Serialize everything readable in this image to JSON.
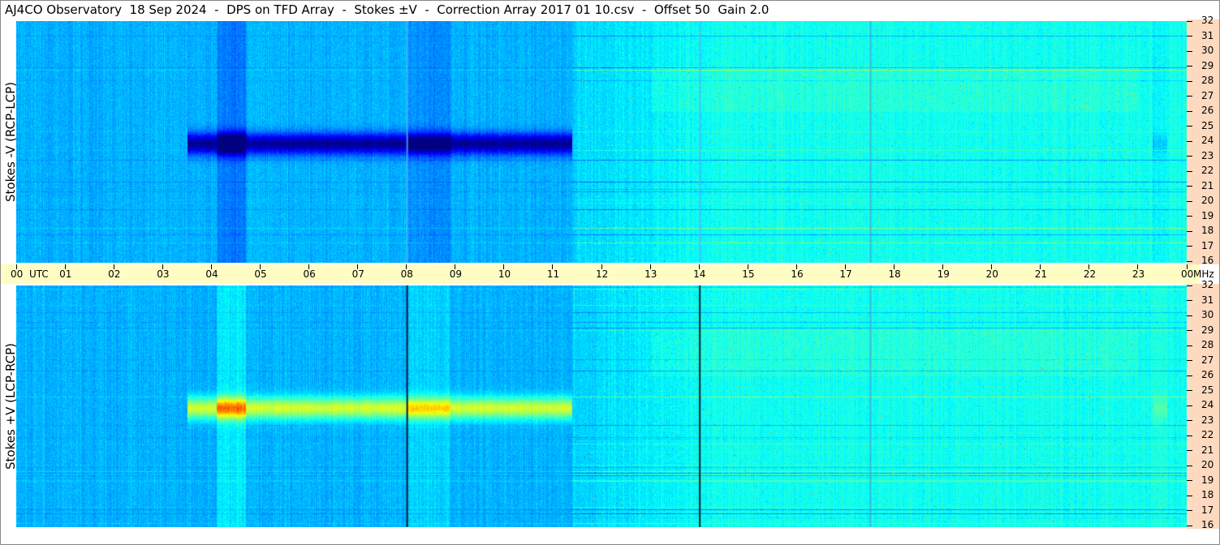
{
  "title": "AJ4CO Observatory  18 Sep 2024  -  DPS on TFD Array  -  Stokes ±V  -  Correction Array 2017 01 10.csv  -  Offset 50  Gain 2.0",
  "chart_data": [
    {
      "type": "heatmap",
      "ylabel": "Stokes -V (RCP-LCP)",
      "y_unit": "MHz",
      "x_ticks": [
        "00",
        "01",
        "02",
        "03",
        "04",
        "05",
        "06",
        "07",
        "08",
        "09",
        "10",
        "11",
        "12",
        "13",
        "14",
        "15",
        "16",
        "17",
        "18",
        "19",
        "20",
        "21",
        "22",
        "23",
        "00"
      ],
      "x_range": [
        0,
        24
      ],
      "y_ticks": [
        "32",
        "31",
        "30",
        "29",
        "28",
        "27",
        "26",
        "25",
        "24",
        "23",
        "22",
        "21",
        "20",
        "19",
        "18",
        "17",
        "16"
      ],
      "y_range": [
        16,
        32
      ]
    },
    {
      "type": "heatmap",
      "ylabel": "Stokes +V (LCP-RCP)",
      "y_unit": "MHz",
      "x_ticks": [
        "00",
        "01",
        "02",
        "03",
        "04",
        "05",
        "06",
        "07",
        "08",
        "09",
        "10",
        "11",
        "12",
        "13",
        "14",
        "15",
        "16",
        "17",
        "18",
        "19",
        "20",
        "21",
        "22",
        "23",
        "00"
      ],
      "x_range": [
        0,
        24
      ],
      "y_ticks": [
        "32",
        "31",
        "30",
        "29",
        "28",
        "27",
        "26",
        "25",
        "24",
        "23",
        "22",
        "21",
        "20",
        "19",
        "18",
        "17",
        "16"
      ],
      "y_range": [
        16,
        32
      ]
    }
  ],
  "time_axis": {
    "first_label": "00",
    "unit_label": "UTC",
    "last_unit": "MHz",
    "labels": [
      "01",
      "02",
      "03",
      "04",
      "05",
      "06",
      "07",
      "08",
      "09",
      "10",
      "11",
      "12",
      "13",
      "14",
      "15",
      "16",
      "17",
      "18",
      "19",
      "20",
      "21",
      "22",
      "23",
      "00"
    ]
  },
  "colors": {
    "time_axis_bg": "#fffdc4",
    "freq_axis_bg": "#fdd9bf",
    "colormap": "jet"
  }
}
